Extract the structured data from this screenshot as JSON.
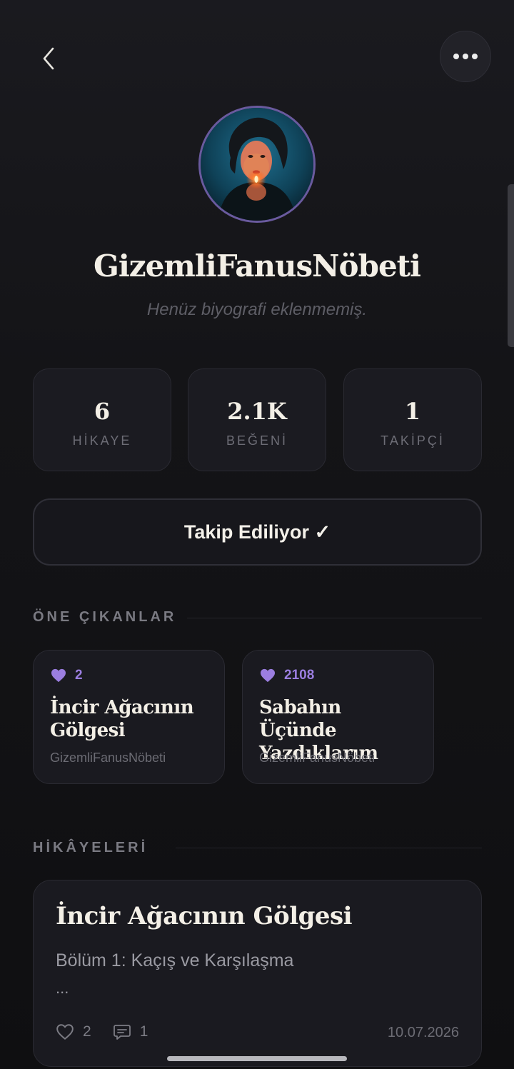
{
  "header": {
    "back_icon": "chevron-left-icon",
    "more_icon": "more-horizontal-icon"
  },
  "profile": {
    "username": "GizemliFanusNöbeti",
    "bio": "Henüz biyografi eklenmemiş.",
    "avatar_ring_color": "#6a5a9e"
  },
  "stats": [
    {
      "value": "6",
      "label": "HİKAYE"
    },
    {
      "value": "2.1K",
      "label": "BEĞENİ"
    },
    {
      "value": "1",
      "label": "TAKİPÇİ"
    }
  ],
  "follow_button": {
    "label": "Takip Ediliyor ✓"
  },
  "featured": {
    "title": "ÖNE ÇIKANLAR",
    "items": [
      {
        "likes": "2",
        "title": "İncir Ağacının Gölgesi",
        "author": "GizemliFanusNöbeti"
      },
      {
        "likes": "2108",
        "title": "Sabahın Üçünde Yazdıklarım",
        "author": "GizemliFanusNöbeti"
      }
    ]
  },
  "stories": {
    "title": "HİKÂYELERİ",
    "items": [
      {
        "title": "İncir Ağacının Gölgesi",
        "chapter": "Bölüm 1: Kaçış ve Karşılaşma",
        "excerpt": "...",
        "likes": "2",
        "comments": "1",
        "date": "10.07.2026"
      }
    ]
  },
  "colors": {
    "accent": "#9b7ee0",
    "background": "#141417",
    "card": "#1a1a20"
  }
}
